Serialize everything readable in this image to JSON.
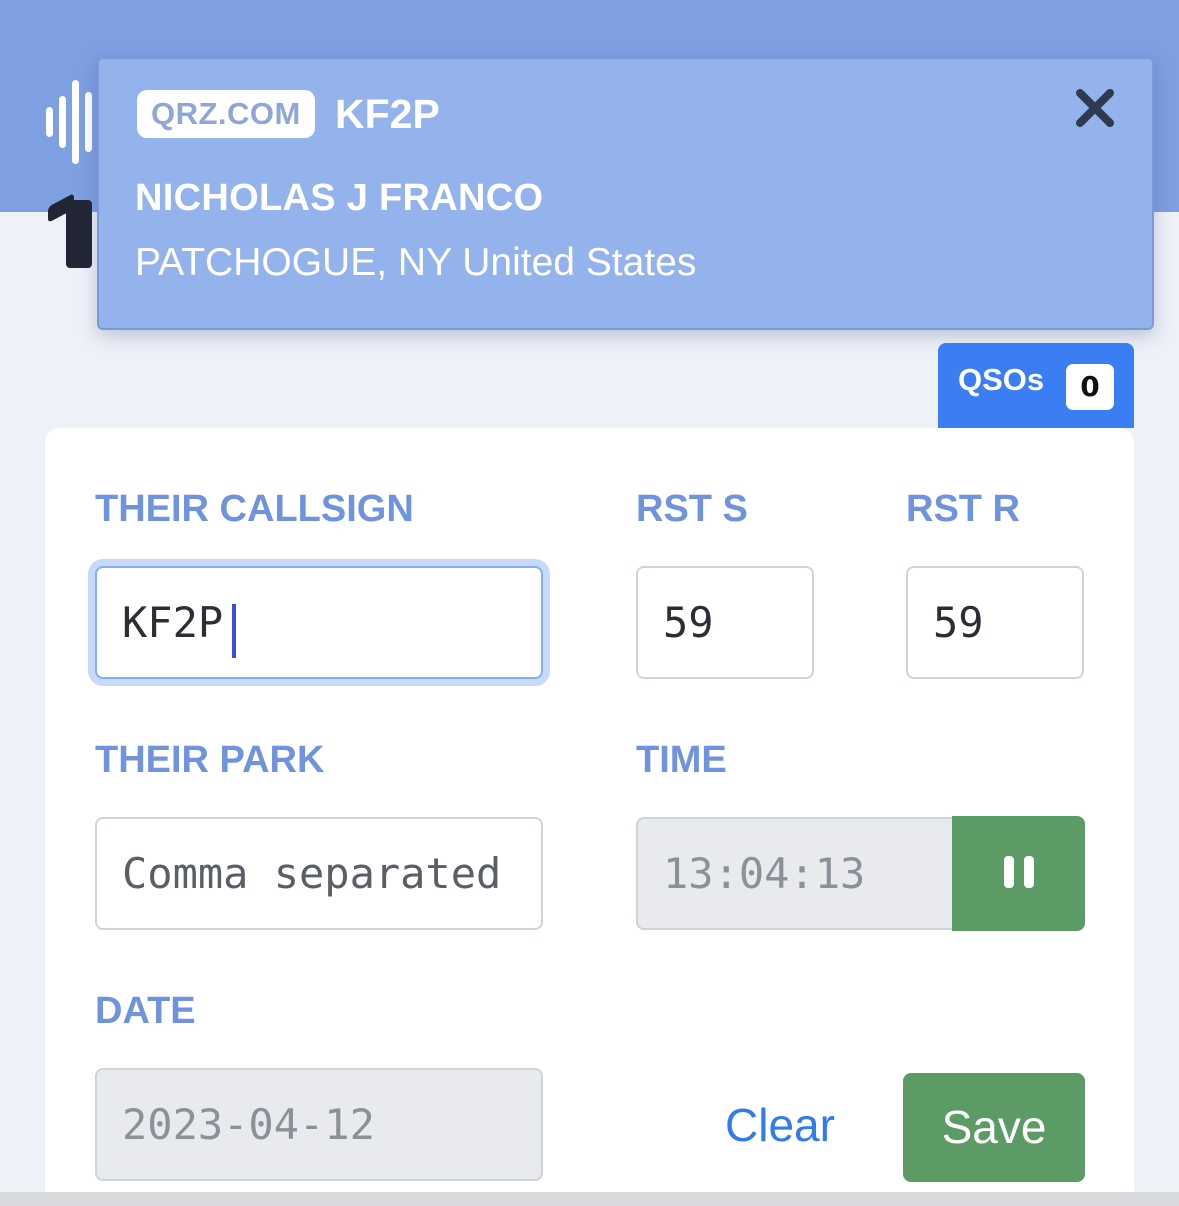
{
  "colors": {
    "header": "#7f9fe3",
    "popup": "#94b2ec",
    "label": "#6f93df",
    "primary": "#3b7df2",
    "success": "#5d9b66",
    "link": "#2f7bef"
  },
  "header": {
    "logo_icon": "audio-wave-icon"
  },
  "qrz_popup": {
    "badge": "QRZ.COM",
    "callsign": "KF2P",
    "name": "NICHOLAS J FRANCO",
    "location": "PATCHOGUE, NY United States",
    "close_icon": "close-icon"
  },
  "qsos": {
    "label": "QSOs",
    "count": "0"
  },
  "form": {
    "their_callsign": {
      "label": "THEIR CALLSIGN",
      "value": "KF2P"
    },
    "rst_s": {
      "label": "RST S",
      "value": "59"
    },
    "rst_r": {
      "label": "RST R",
      "value": "59"
    },
    "their_park": {
      "label": "THEIR PARK",
      "value": "",
      "placeholder": "Comma separated"
    },
    "time": {
      "label": "TIME",
      "value": "13:04:13",
      "pause_icon": "pause-icon"
    },
    "date": {
      "label": "DATE",
      "value": "2023-04-12"
    }
  },
  "actions": {
    "clear": "Clear",
    "save": "Save"
  }
}
